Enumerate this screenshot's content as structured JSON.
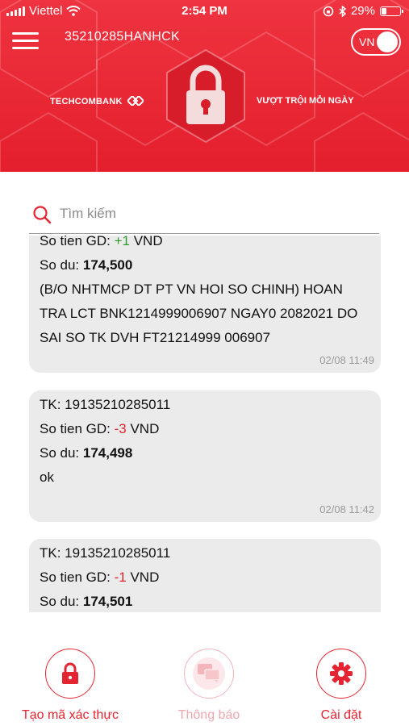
{
  "status_bar": {
    "carrier": "Viettel",
    "time": "2:54 PM",
    "battery": "29%",
    "battery_level": 0.29
  },
  "header": {
    "account_id": "35210285HANHCK",
    "language": "VN",
    "brand_left": "TECHCOMBANK",
    "brand_right": "VƯỢT TRỘI MỖI NGÀY"
  },
  "search": {
    "placeholder": "Tìm kiếm"
  },
  "messages": [
    {
      "tx_prefix": "So tien GD: ",
      "tx_amount": "+1",
      "tx_suffix": " VND",
      "balance_label": "So du: ",
      "balance": "174,500",
      "note": "(B/O NHTMCP DT PT VN HOI SO CHINH) HOAN TRA LCT BNK1214999006907 NGAY0 2082021 DO SAI SO TK DVH FT21214999 006907",
      "timestamp": "02/08 11:49"
    },
    {
      "account": "TK: 19135210285011",
      "tx_prefix": "So tien GD: ",
      "tx_amount": "-3",
      "tx_suffix": " VND",
      "balance_label": "So du: ",
      "balance": "174,498",
      "note": "ok",
      "timestamp": "02/08 11:42"
    },
    {
      "account": "TK: 19135210285011",
      "tx_prefix": "So tien GD: ",
      "tx_amount": "-1",
      "tx_suffix": " VND",
      "balance_label": "So du: ",
      "balance": "174,501"
    }
  ],
  "bottom_nav": [
    {
      "label": "Tạo mã xác thực",
      "icon": "lock-icon",
      "active": true
    },
    {
      "label": "Thông báo",
      "icon": "chat-icon",
      "active": false
    },
    {
      "label": "Cài đặt",
      "icon": "gear-icon",
      "active": true
    }
  ],
  "colors": {
    "brand_red": "#e52431",
    "positive": "#2a9d2a",
    "negative": "#e52431"
  }
}
